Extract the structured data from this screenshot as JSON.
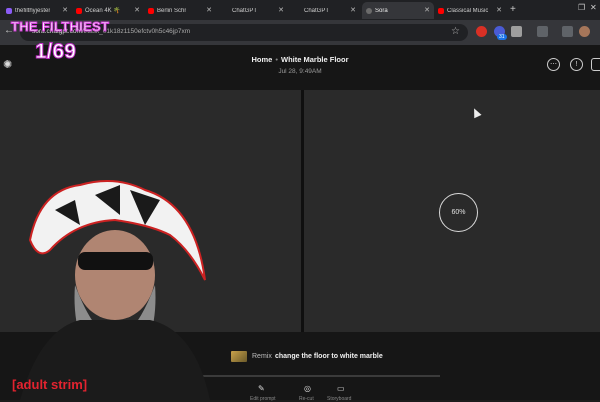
{
  "browser": {
    "tabs": [
      {
        "label": "thefilthyjester",
        "fav": "#8b5cf6"
      },
      {
        "label": "Ocean 4K 🌴",
        "fav": "#ff0000"
      },
      {
        "label": "Berlin Schr",
        "fav": "#ff0000"
      },
      {
        "label": "ChatGPT",
        "fav": "#6b6b6b"
      },
      {
        "label": "ChatGPT",
        "fav": "#6b6b6b"
      },
      {
        "label": "Sora",
        "fav": "#6b6b6b"
      },
      {
        "label": "Classical Music",
        "fav": "#ff0000"
      }
    ],
    "active_tab_index": 5,
    "new_tab_glyph": "+",
    "url_host": "sora.chatgpt.com",
    "url_path": "/t/task_01k18z1150efctv0h5c46jp7xm"
  },
  "app": {
    "breadcrumb_home": "Home",
    "breadcrumb_separator": "•",
    "breadcrumb_current": "White Marble Floor",
    "date": "Jul 28, 9:49AM",
    "progress_label": "60%",
    "progress_value": 0.6,
    "remix_label": "Remix",
    "prompt_text": "change the floor to white marble",
    "actions": [
      "Edit prompt",
      "Re-cut",
      "Storyboard"
    ]
  },
  "overlay": {
    "title": "THE FILTHIEST",
    "count": "1/69",
    "tag": "[adult strim]"
  },
  "colors": {
    "accent_overlay": "#d13ad8",
    "tag_red": "#e3232f",
    "pane_bg": "#2a2a2a"
  }
}
